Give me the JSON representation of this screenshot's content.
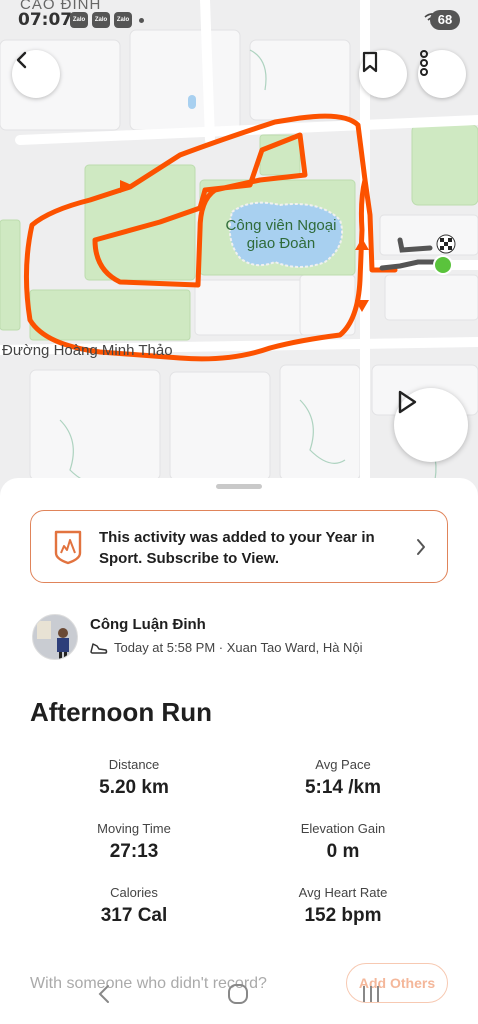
{
  "status_bar": {
    "place_label": "CAO ĐỈNH",
    "time": "07:07",
    "zalo_labels": [
      "Zalo",
      "Zalo",
      "Zalo"
    ],
    "battery": "68"
  },
  "map": {
    "park_label_line1": "Công viên Ngoại",
    "park_label_line2": "giao Đoàn",
    "road_label": "Đường Hoàng Minh Thảo",
    "colors": {
      "route": "#fc5200",
      "park": "#cfe9c2",
      "start_marker": "#5ac33c"
    }
  },
  "top_bar": {
    "back_icon": "chevron-left-icon",
    "bookmark_icon": "bookmark-icon",
    "more_icon": "more-vertical-icon"
  },
  "play_icon": "play-icon",
  "banner": {
    "text": "This activity was added to your Year in Sport. Subscribe to View.",
    "icon": "year-in-sport-badge-icon"
  },
  "athlete": {
    "name": "Công Luận Đinh",
    "meta": "Today at 5:58 PM · Xuan Tao Ward, Hà Nội"
  },
  "activity_title": "Afternoon Run",
  "stats": [
    {
      "label": "Distance",
      "value": "5.20 km"
    },
    {
      "label": "Avg Pace",
      "value": "5:14 /km"
    },
    {
      "label": "Moving Time",
      "value": "27:13"
    },
    {
      "label": "Elevation Gain",
      "value": "0 m"
    },
    {
      "label": "Calories",
      "value": "317 Cal"
    },
    {
      "label": "Avg Heart Rate",
      "value": "152 bpm"
    }
  ],
  "footer": {
    "prompt": "With someone who didn't record?",
    "add_button": "Add Others"
  }
}
